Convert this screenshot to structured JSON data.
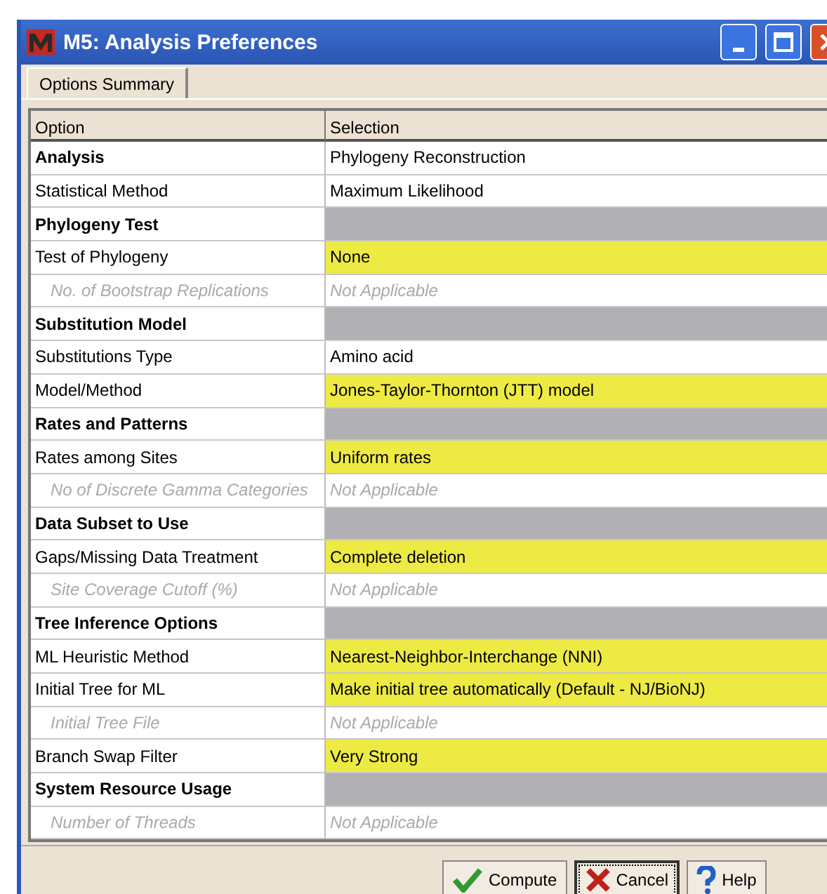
{
  "window": {
    "title": "M5: Analysis Preferences"
  },
  "tabs": [
    {
      "label": "Options Summary",
      "selected": true
    }
  ],
  "table": {
    "columns": [
      "Option",
      "Selection"
    ],
    "rows": [
      {
        "kind": "section",
        "option": "Analysis",
        "selection": "Phylogeny Reconstruction",
        "highlighted": false
      },
      {
        "kind": "option",
        "option": "Statistical Method",
        "selection": "Maximum Likelihood",
        "highlighted": false
      },
      {
        "kind": "section",
        "option": "Phylogeny Test"
      },
      {
        "kind": "option",
        "option": "Test of Phylogeny",
        "selection": "None",
        "highlighted": true
      },
      {
        "kind": "disabled",
        "option": "No. of Bootstrap Replications",
        "selection": "Not Applicable"
      },
      {
        "kind": "section",
        "option": "Substitution Model"
      },
      {
        "kind": "option",
        "option": "Substitutions Type",
        "selection": "Amino acid",
        "highlighted": false
      },
      {
        "kind": "option",
        "option": "Model/Method",
        "selection": "Jones-Taylor-Thornton (JTT) model",
        "highlighted": true
      },
      {
        "kind": "section",
        "option": "Rates and Patterns"
      },
      {
        "kind": "option",
        "option": "Rates among Sites",
        "selection": "Uniform rates",
        "highlighted": true
      },
      {
        "kind": "disabled",
        "option": "No of Discrete Gamma Categories",
        "selection": "Not Applicable"
      },
      {
        "kind": "section",
        "option": "Data Subset to Use"
      },
      {
        "kind": "option",
        "option": "Gaps/Missing Data Treatment",
        "selection": "Complete deletion",
        "highlighted": true
      },
      {
        "kind": "disabled",
        "option": "Site Coverage Cutoff (%)",
        "selection": "Not Applicable"
      },
      {
        "kind": "section",
        "option": "Tree Inference Options"
      },
      {
        "kind": "option",
        "option": "ML Heuristic Method",
        "selection": "Nearest-Neighbor-Interchange (NNI)",
        "highlighted": true
      },
      {
        "kind": "option",
        "option": "Initial Tree for ML",
        "selection": "Make initial tree automatically (Default - NJ/BioNJ)",
        "highlighted": true
      },
      {
        "kind": "disabled",
        "option": "Initial Tree File",
        "selection": "Not Applicable"
      },
      {
        "kind": "option",
        "option": "Branch Swap Filter",
        "selection": "Very Strong",
        "highlighted": true
      },
      {
        "kind": "section",
        "option": "System Resource Usage"
      },
      {
        "kind": "disabled",
        "option": "Number of Threads",
        "selection": "Not Applicable"
      }
    ]
  },
  "buttons": [
    {
      "kind": "compute",
      "label": "Compute",
      "focused": false
    },
    {
      "kind": "cancel",
      "label": "Cancel",
      "focused": true
    },
    {
      "kind": "help",
      "label": "Help",
      "focused": false
    }
  ]
}
